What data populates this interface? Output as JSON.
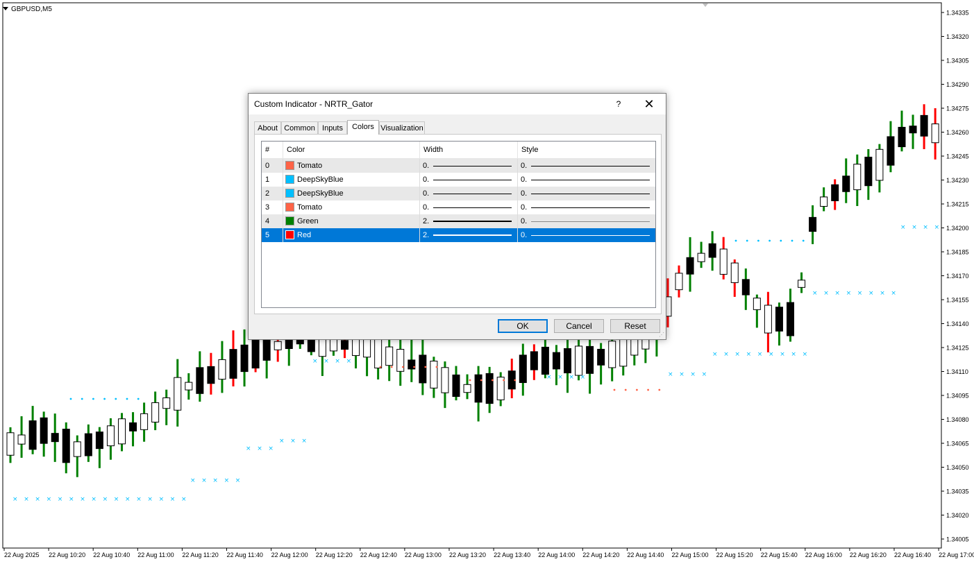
{
  "chart": {
    "symbol": "GBPUSD,M5",
    "price_labels": [
      "1.34335",
      "1.34320",
      "1.34305",
      "1.34290",
      "1.34275",
      "1.34260",
      "1.34245",
      "1.34230",
      "1.34215",
      "1.34200",
      "1.34185",
      "1.34170",
      "1.34155",
      "1.34140",
      "1.34125",
      "1.34110",
      "1.34095",
      "1.34080",
      "1.34065",
      "1.34050",
      "1.34035",
      "1.34020",
      "1.34005"
    ],
    "time_labels": [
      "22 Aug 2025",
      "22 Aug 10:20",
      "22 Aug 10:40",
      "22 Aug 11:00",
      "22 Aug 11:20",
      "22 Aug 11:40",
      "22 Aug 12:00",
      "22 Aug 12:20",
      "22 Aug 12:40",
      "22 Aug 13:00",
      "22 Aug 13:20",
      "22 Aug 13:40",
      "22 Aug 14:00",
      "22 Aug 14:20",
      "22 Aug 14:40",
      "22 Aug 15:00",
      "22 Aug 15:20",
      "22 Aug 15:40",
      "22 Aug 16:00",
      "22 Aug 16:20",
      "22 Aug 16:40",
      "22 Aug 17:00"
    ],
    "colors": {
      "bull_wick": "#008000",
      "bear_wick": "#ff0000",
      "candle_body_up": "#ffffff",
      "candle_body_down": "#000000",
      "stop_marker": "#00bfff",
      "dot_marker": "#ff6347"
    }
  },
  "dialog": {
    "title": "Custom Indicator - NRTR_Gator",
    "help_label": "?",
    "close_label": "✕",
    "tabs": [
      "About",
      "Common",
      "Inputs",
      "Colors",
      "Visualization"
    ],
    "active_tab": "Colors",
    "columns": {
      "index": "#",
      "color": "Color",
      "width": "Width",
      "style": "Style"
    },
    "rows": [
      {
        "index": "0",
        "color_name": "Tomato",
        "swatch": "#ff6347",
        "width": "0.",
        "style": "0."
      },
      {
        "index": "1",
        "color_name": "DeepSkyBlue",
        "swatch": "#00bfff",
        "width": "0.",
        "style": "0."
      },
      {
        "index": "2",
        "color_name": "DeepSkyBlue",
        "swatch": "#00bfff",
        "width": "0.",
        "style": "0."
      },
      {
        "index": "3",
        "color_name": "Tomato",
        "swatch": "#ff6347",
        "width": "0.",
        "style": "0."
      },
      {
        "index": "4",
        "color_name": "Green",
        "swatch": "#008000",
        "width": "2.",
        "style": "0."
      },
      {
        "index": "5",
        "color_name": "Red",
        "swatch": "#ff0000",
        "width": "2.",
        "style": "0."
      }
    ],
    "selected_row": 5,
    "buttons": {
      "ok": "OK",
      "cancel": "Cancel",
      "reset": "Reset"
    },
    "selection_color": "#0078d7"
  }
}
